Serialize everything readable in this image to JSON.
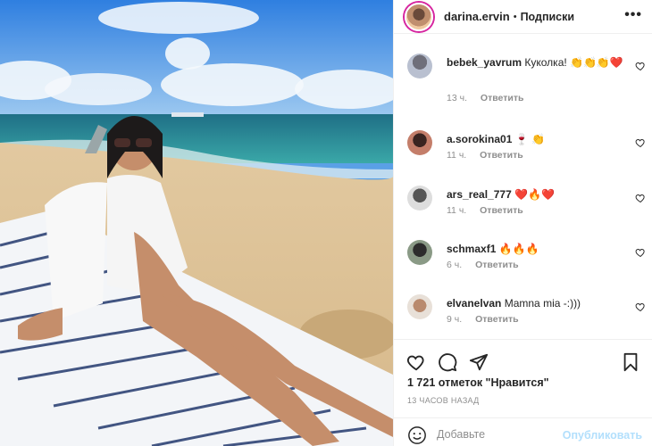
{
  "header": {
    "username": "darina.ervin",
    "separator": "•",
    "follow_status": "Подписки",
    "more_label": "•••"
  },
  "comments": [
    {
      "user": "bebek_yavrum",
      "text": "Куколка! 👏👏👏❤️",
      "time": "13 ч.",
      "reply": "Ответить"
    },
    {
      "user": "a.sorokina01",
      "text": "🍷 👏",
      "time": "11 ч.",
      "reply": "Ответить"
    },
    {
      "user": "ars_real_777",
      "text": "❤️🔥❤️",
      "time": "11 ч.",
      "reply": "Ответить"
    },
    {
      "user": "schmaxf1",
      "text": "🔥🔥🔥",
      "time": "6 ч.",
      "reply": "Ответить"
    },
    {
      "user": "elvanelvan",
      "text": "Mamna mia -:)))",
      "time": "9 ч.",
      "reply": "Ответить"
    }
  ],
  "post": {
    "likes": "1 721 отметок \"Нравится\"",
    "time_ago": "13 ЧАСОВ НАЗАД"
  },
  "add_comment": {
    "placeholder": "Добавьте",
    "post_label": "Опубликовать"
  },
  "colors": {
    "text": "#262626",
    "muted": "#8e8e8e",
    "post_disabled": "#b2dffc",
    "story_ring": "#d6249f"
  }
}
